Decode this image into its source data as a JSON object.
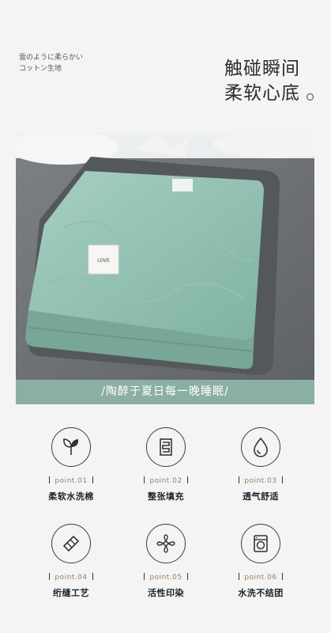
{
  "header": {
    "jp_line1": "雲のように柔らかい",
    "jp_line2": "コットン生地",
    "title_line1": "触碰瞬间",
    "title_line2": "柔软心底"
  },
  "product": {
    "label_text": "LOVE",
    "colors": {
      "quilt": "#8fbcae",
      "border": "#5a5c5e",
      "sheet": "#6f7175",
      "banner": "#8bafa5"
    }
  },
  "banner": {
    "text": "/陶醉于夏日每一晚睡眠/"
  },
  "features": [
    {
      "point": "point.01",
      "label": "柔软水洗棉",
      "icon": "leaves-icon"
    },
    {
      "point": "point.02",
      "label": "整张填充",
      "icon": "layers-icon"
    },
    {
      "point": "point.03",
      "label": "透气舒适",
      "icon": "droplet-icon"
    },
    {
      "point": "point.04",
      "label": "绗缝工艺",
      "icon": "quilt-stitch-icon"
    },
    {
      "point": "point.05",
      "label": "活性印染",
      "icon": "pinwheel-flower-icon"
    },
    {
      "point": "point.06",
      "label": "水洗不结团",
      "icon": "washing-machine-icon"
    }
  ]
}
